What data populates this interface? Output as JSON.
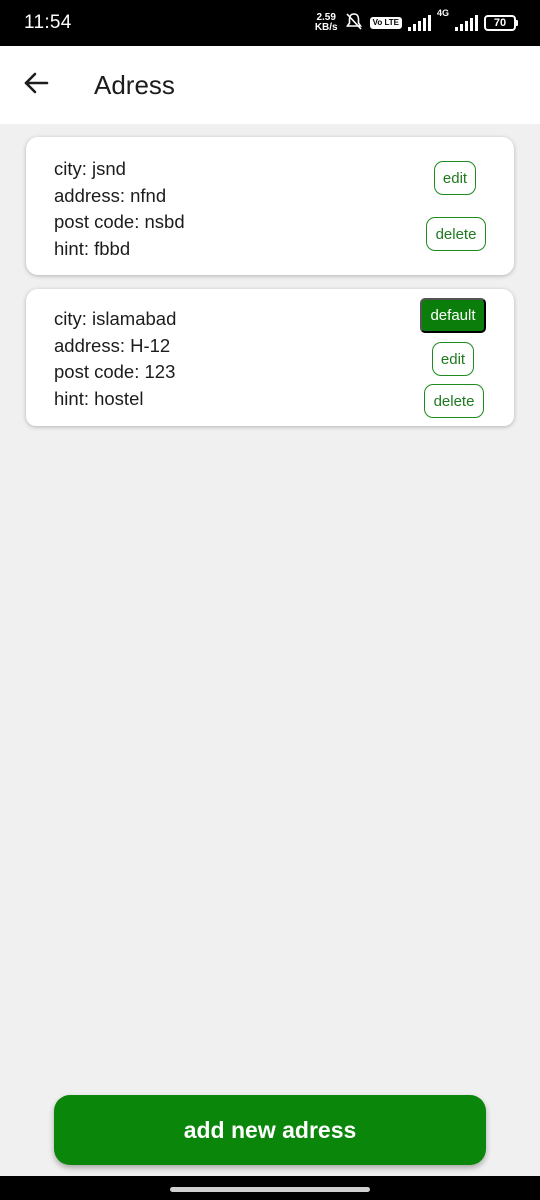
{
  "status_bar": {
    "time": "11:54",
    "net_speed_value": "2.59",
    "net_speed_unit": "KB/s",
    "volte_label": "Vo LTE",
    "network_gen": "4G",
    "battery": "70"
  },
  "header": {
    "title": "Adress"
  },
  "addresses": [
    {
      "lines": [
        "city: jsnd",
        "address: nfnd",
        "post code: nsbd",
        "hint: fbbd"
      ],
      "edit_label": "edit",
      "delete_label": "delete"
    },
    {
      "lines": [
        "city: islamabad",
        "address: H-12",
        "post code: 123",
        "hint: hostel"
      ],
      "default_label": "default",
      "edit_label": "edit",
      "delete_label": "delete"
    }
  ],
  "footer": {
    "add_label": "add new adress"
  },
  "colors": {
    "accent": "#0a860a",
    "background": "#f0f0f0",
    "card": "#ffffff"
  }
}
